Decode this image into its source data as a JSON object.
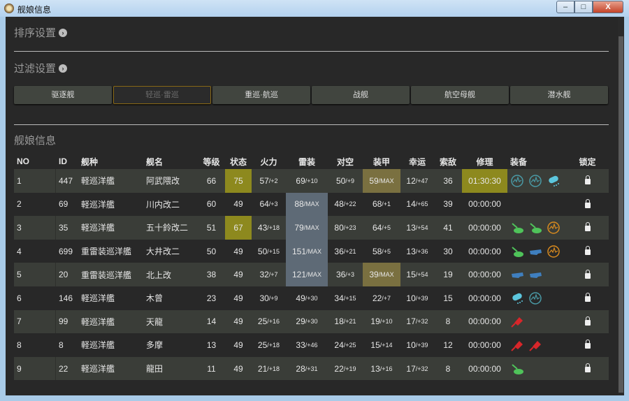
{
  "window": {
    "title": "舰娘信息",
    "min": "–",
    "max": "□",
    "close": "X"
  },
  "sort_section": {
    "title": "排序设置"
  },
  "filter_section": {
    "title": "过滤设置",
    "buttons": [
      {
        "label": "驱逐舰",
        "selected": false
      },
      {
        "label": "轻巡·雷巡",
        "selected": true
      },
      {
        "label": "重巡·航巡",
        "selected": false
      },
      {
        "label": "战舰",
        "selected": false
      },
      {
        "label": "航空母舰",
        "selected": false
      },
      {
        "label": "潜水舰",
        "selected": false
      }
    ]
  },
  "ships_section": {
    "title": "舰娘信息"
  },
  "columns": [
    "NO",
    "ID",
    "舰种",
    "舰名",
    "等级",
    "状态",
    "火力",
    "雷装",
    "对空",
    "装甲",
    "幸运",
    "索敌",
    "修理",
    "装备",
    "锁定"
  ],
  "colors": {
    "cond_highlight": "#8d891e",
    "armor_max": "#7a7040",
    "torpedo_max": "#5e6a76",
    "radar_teal": "#4a9aa6",
    "radar_orange": "#d88a1e",
    "gun_green": "#4fc35a",
    "gun_blue": "#3f7fbf",
    "torpedo_red": "#d8262a",
    "drum_cyan": "#5cc6dd"
  },
  "rows": [
    {
      "no": "1",
      "id": "447",
      "type": "軽巡洋艦",
      "name": "阿武隈改",
      "lv": "66",
      "cond": "75",
      "cond_hl": true,
      "fp": [
        "57",
        "/+2"
      ],
      "tp": [
        "69",
        "/+10"
      ],
      "tp_max": false,
      "aa": [
        "50",
        "/+9"
      ],
      "ar": [
        "59",
        "/MAX"
      ],
      "ar_max": true,
      "luck": [
        "12",
        "/+47"
      ],
      "los": "36",
      "repair": "01:30:30",
      "repair_hl": true,
      "equip": [
        "radar-teal",
        "radar-teal",
        "drum-cyan"
      ]
    },
    {
      "no": "2",
      "id": "69",
      "type": "軽巡洋艦",
      "name": "川内改二",
      "lv": "60",
      "cond": "49",
      "cond_hl": false,
      "fp": [
        "64",
        "/+3"
      ],
      "tp": [
        "88",
        "/MAX"
      ],
      "tp_max": true,
      "aa": [
        "48",
        "/+22"
      ],
      "ar": [
        "68",
        "/+1"
      ],
      "ar_max": false,
      "luck": [
        "14",
        "/+65"
      ],
      "los": "39",
      "repair": "00:00:00",
      "repair_hl": false,
      "equip": []
    },
    {
      "no": "3",
      "id": "35",
      "type": "軽巡洋艦",
      "name": "五十鈴改二",
      "lv": "51",
      "cond": "67",
      "cond_hl": true,
      "fp": [
        "43",
        "/+18"
      ],
      "tp": [
        "79",
        "/MAX"
      ],
      "tp_max": true,
      "aa": [
        "80",
        "/+23"
      ],
      "ar": [
        "64",
        "/+5"
      ],
      "ar_max": false,
      "luck": [
        "13",
        "/+54"
      ],
      "los": "41",
      "repair": "00:00:00",
      "repair_hl": false,
      "equip": [
        "gun-green",
        "gun-green",
        "radar-orange"
      ]
    },
    {
      "no": "4",
      "id": "699",
      "type": "重雷装巡洋艦",
      "name": "大井改二",
      "lv": "50",
      "cond": "49",
      "cond_hl": false,
      "fp": [
        "50",
        "/+15"
      ],
      "tp": [
        "151",
        "/MAX"
      ],
      "tp_max": true,
      "aa": [
        "36",
        "/+21"
      ],
      "ar": [
        "58",
        "/+5"
      ],
      "ar_max": false,
      "luck": [
        "13",
        "/+36"
      ],
      "los": "30",
      "repair": "00:00:00",
      "repair_hl": false,
      "equip": [
        "gun-green",
        "gun-blue",
        "radar-orange"
      ]
    },
    {
      "no": "5",
      "id": "20",
      "type": "重雷装巡洋艦",
      "name": "北上改",
      "lv": "38",
      "cond": "49",
      "cond_hl": false,
      "fp": [
        "32",
        "/+7"
      ],
      "tp": [
        "121",
        "/MAX"
      ],
      "tp_max": true,
      "aa": [
        "36",
        "/+3"
      ],
      "ar": [
        "39",
        "/MAX"
      ],
      "ar_max": true,
      "luck": [
        "15",
        "/+54"
      ],
      "los": "19",
      "repair": "00:00:00",
      "repair_hl": false,
      "equip": [
        "gun-blue",
        "gun-blue"
      ]
    },
    {
      "no": "6",
      "id": "146",
      "type": "軽巡洋艦",
      "name": "木曾",
      "lv": "23",
      "cond": "49",
      "cond_hl": false,
      "fp": [
        "30",
        "/+9"
      ],
      "tp": [
        "49",
        "/+30"
      ],
      "tp_max": false,
      "aa": [
        "34",
        "/+15"
      ],
      "ar": [
        "22",
        "/+7"
      ],
      "ar_max": false,
      "luck": [
        "10",
        "/+39"
      ],
      "los": "15",
      "repair": "00:00:00",
      "repair_hl": false,
      "equip": [
        "drum-cyan",
        "radar-teal"
      ]
    },
    {
      "no": "7",
      "id": "99",
      "type": "軽巡洋艦",
      "name": "天龍",
      "lv": "14",
      "cond": "49",
      "cond_hl": false,
      "fp": [
        "25",
        "/+16"
      ],
      "tp": [
        "29",
        "/+30"
      ],
      "tp_max": false,
      "aa": [
        "18",
        "/+21"
      ],
      "ar": [
        "19",
        "/+10"
      ],
      "ar_max": false,
      "luck": [
        "17",
        "/+32"
      ],
      "los": "8",
      "repair": "00:00:00",
      "repair_hl": false,
      "equip": [
        "torpedo-red"
      ]
    },
    {
      "no": "8",
      "id": "8",
      "type": "軽巡洋艦",
      "name": "多摩",
      "lv": "13",
      "cond": "49",
      "cond_hl": false,
      "fp": [
        "25",
        "/+18"
      ],
      "tp": [
        "33",
        "/+46"
      ],
      "tp_max": false,
      "aa": [
        "24",
        "/+25"
      ],
      "ar": [
        "15",
        "/+14"
      ],
      "ar_max": false,
      "luck": [
        "10",
        "/+39"
      ],
      "los": "12",
      "repair": "00:00:00",
      "repair_hl": false,
      "equip": [
        "torpedo-red",
        "torpedo-red"
      ]
    },
    {
      "no": "9",
      "id": "22",
      "type": "軽巡洋艦",
      "name": "龍田",
      "lv": "11",
      "cond": "49",
      "cond_hl": false,
      "fp": [
        "21",
        "/+18"
      ],
      "tp": [
        "28",
        "/+31"
      ],
      "tp_max": false,
      "aa": [
        "22",
        "/+19"
      ],
      "ar": [
        "13",
        "/+16"
      ],
      "ar_max": false,
      "luck": [
        "17",
        "/+32"
      ],
      "los": "8",
      "repair": "00:00:00",
      "repair_hl": false,
      "equip": [
        "gun-green"
      ]
    }
  ]
}
